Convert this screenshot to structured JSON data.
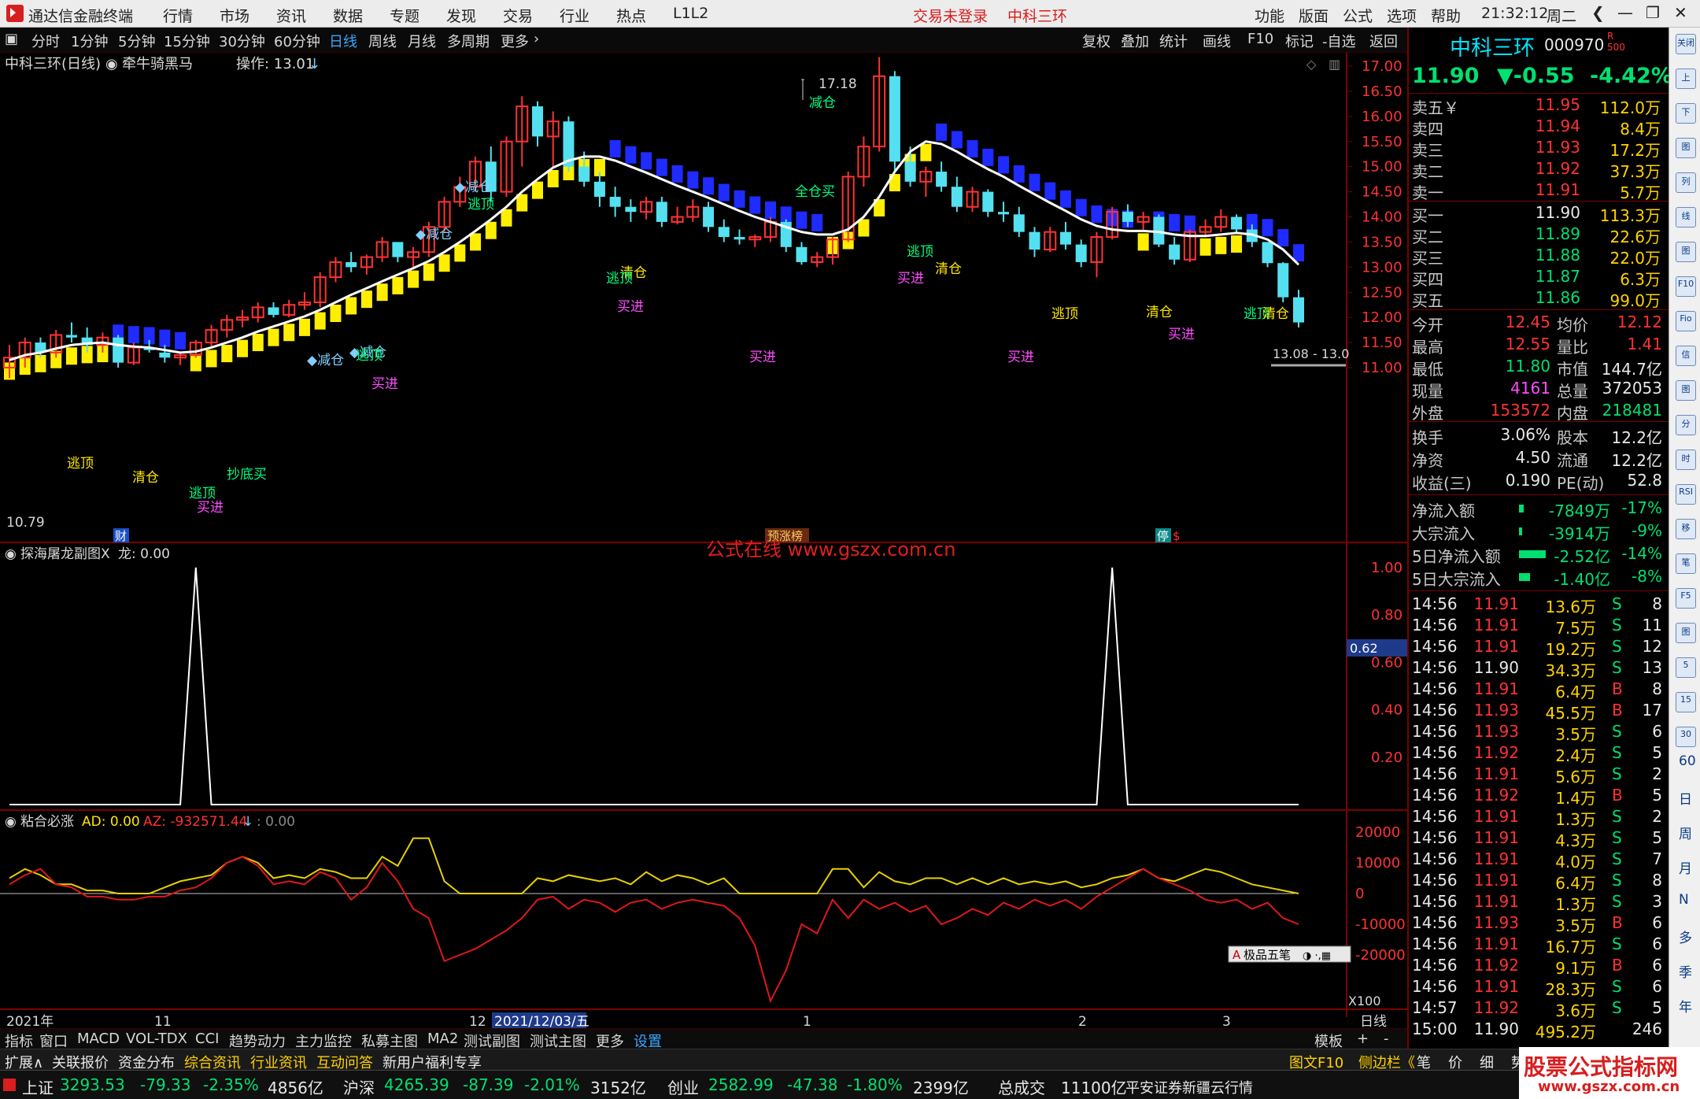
{
  "app": {
    "name": "通达信金融终端"
  },
  "menu": [
    "行情",
    "市场",
    "资讯",
    "数据",
    "专题",
    "发现",
    "交易",
    "行业",
    "热点",
    "L1L2"
  ],
  "menu_red": [
    "交易未登录",
    "中科三环"
  ],
  "menu_right": [
    "功能",
    "版面",
    "公式",
    "选项",
    "帮助"
  ],
  "clock": "21:32:12",
  "weekday": "周二",
  "toolbar_left": [
    "分时",
    "1分钟",
    "5分钟",
    "15分钟",
    "30分钟",
    "60分钟",
    "日线",
    "周线",
    "月线",
    "多周期",
    "更多"
  ],
  "toolbar_active": "日线",
  "toolbar_right": [
    "复权",
    "叠加",
    "统计",
    "画线",
    "F10",
    "标记",
    "-自选",
    "返回"
  ],
  "main_pane": {
    "title": "中科三环(日线)",
    "formula": "牵牛骑黑马",
    "operation": "操作: 13.01",
    "high_label": "17.18",
    "low_label": "10.79",
    "last_label": "13.08 - 13.0",
    "badges": {
      "cai": "财",
      "yuzhang": "预涨榜",
      "ting": "停"
    },
    "watermark": "公式在线  www.gszx.com.cn"
  },
  "sub1": {
    "title": "探海屠龙副图X",
    "value": "龙: 0.00",
    "marker": "0.62"
  },
  "sub2": {
    "title": "粘合必涨",
    "ad": "AD: 0.00",
    "az": "AZ: -932571.44",
    "extra": ": 0.00",
    "scale": "X100"
  },
  "date_axis": {
    "labels": [
      "2021年",
      "11",
      "12",
      "2021/12/03/五",
      "1",
      "2",
      "3",
      "日线"
    ]
  },
  "quote": {
    "name": "中科三环",
    "code": "000970",
    "price": "11.90",
    "change": "▼-0.55",
    "pct": "-4.42%",
    "asks": [
      {
        "label": "卖五￥",
        "price": "11.95",
        "vol": "112.0万"
      },
      {
        "label": "卖四",
        "price": "11.94",
        "vol": "8.4万"
      },
      {
        "label": "卖三",
        "price": "11.93",
        "vol": "17.2万"
      },
      {
        "label": "卖二",
        "price": "11.92",
        "vol": "37.3万"
      },
      {
        "label": "卖一",
        "price": "11.91",
        "vol": "5.7万"
      }
    ],
    "bids": [
      {
        "label": "买一",
        "price": "11.90",
        "vol": "113.3万"
      },
      {
        "label": "买二",
        "price": "11.89",
        "vol": "22.6万"
      },
      {
        "label": "买三",
        "price": "11.88",
        "vol": "22.0万"
      },
      {
        "label": "买四",
        "price": "11.87",
        "vol": "6.3万"
      },
      {
        "label": "买五",
        "price": "11.86",
        "vol": "99.0万"
      }
    ],
    "stats": [
      {
        "k1": "今开",
        "v1": "12.45",
        "c1": "red",
        "k2": "均价",
        "v2": "12.12",
        "c2": "red"
      },
      {
        "k1": "最高",
        "v1": "12.55",
        "c1": "red",
        "k2": "量比",
        "v2": "1.41",
        "c2": "red"
      },
      {
        "k1": "最低",
        "v1": "11.80",
        "c1": "green",
        "k2": "市值",
        "v2": "144.7亿",
        "c2": "white"
      },
      {
        "k1": "现量",
        "v1": "4161",
        "c1": "magenta",
        "k2": "总量",
        "v2": "372053",
        "c2": "white"
      },
      {
        "k1": "外盘",
        "v1": "153572",
        "c1": "red",
        "k2": "内盘",
        "v2": "218481",
        "c2": "green"
      }
    ],
    "stats2": [
      {
        "k1": "换手",
        "v1": "3.06%",
        "c1": "white",
        "k2": "股本",
        "v2": "12.2亿",
        "c2": "white"
      },
      {
        "k1": "净资",
        "v1": "4.50",
        "c1": "white",
        "k2": "流通",
        "v2": "12.2亿",
        "c2": "white"
      },
      {
        "k1": "收益(三)",
        "v1": "0.190",
        "c1": "white",
        "k2": "PE(动)",
        "v2": "52.8",
        "c2": "white"
      }
    ],
    "flows": [
      {
        "label": "净流入额",
        "value": "-7849万",
        "pct": "-17%"
      },
      {
        "label": "大宗流入",
        "value": "-3914万",
        "pct": "-9%"
      },
      {
        "label": "5日净流入额",
        "value": "-2.52亿",
        "pct": "-14%"
      },
      {
        "label": "5日大宗流入",
        "value": "-1.40亿",
        "pct": "-8%"
      }
    ],
    "ticks": [
      {
        "t": "14:56",
        "p": "11.91",
        "v": "13.6万",
        "s": "S",
        "n": "8"
      },
      {
        "t": "14:56",
        "p": "11.91",
        "v": "7.5万",
        "s": "S",
        "n": "11"
      },
      {
        "t": "14:56",
        "p": "11.91",
        "v": "19.2万",
        "s": "S",
        "n": "12"
      },
      {
        "t": "14:56",
        "p": "11.90",
        "v": "34.3万",
        "s": "S",
        "n": "13"
      },
      {
        "t": "14:56",
        "p": "11.91",
        "v": "6.4万",
        "s": "B",
        "n": "8"
      },
      {
        "t": "14:56",
        "p": "11.93",
        "v": "45.5万",
        "s": "B",
        "n": "17"
      },
      {
        "t": "14:56",
        "p": "11.93",
        "v": "3.5万",
        "s": "S",
        "n": "6"
      },
      {
        "t": "14:56",
        "p": "11.92",
        "v": "2.4万",
        "s": "S",
        "n": "5"
      },
      {
        "t": "14:56",
        "p": "11.91",
        "v": "5.6万",
        "s": "S",
        "n": "2"
      },
      {
        "t": "14:56",
        "p": "11.92",
        "v": "1.4万",
        "s": "B",
        "n": "5"
      },
      {
        "t": "14:56",
        "p": "11.91",
        "v": "1.3万",
        "s": "S",
        "n": "2"
      },
      {
        "t": "14:56",
        "p": "11.91",
        "v": "4.3万",
        "s": "S",
        "n": "5"
      },
      {
        "t": "14:56",
        "p": "11.91",
        "v": "4.0万",
        "s": "S",
        "n": "7"
      },
      {
        "t": "14:56",
        "p": "11.91",
        "v": "6.4万",
        "s": "S",
        "n": "8"
      },
      {
        "t": "14:56",
        "p": "11.91",
        "v": "1.3万",
        "s": "S",
        "n": "3"
      },
      {
        "t": "14:56",
        "p": "11.93",
        "v": "3.5万",
        "s": "B",
        "n": "6"
      },
      {
        "t": "14:56",
        "p": "11.91",
        "v": "16.7万",
        "s": "S",
        "n": "6"
      },
      {
        "t": "14:56",
        "p": "11.92",
        "v": "9.1万",
        "s": "B",
        "n": "6"
      },
      {
        "t": "14:56",
        "p": "11.91",
        "v": "28.3万",
        "s": "S",
        "n": "6"
      },
      {
        "t": "14:57",
        "p": "11.92",
        "v": "3.6万",
        "s": "S",
        "n": "5"
      },
      {
        "t": "15:00",
        "p": "11.90",
        "v": "495.2万",
        "s": "",
        "n": "246"
      }
    ]
  },
  "side_icons": [
    "关闭",
    "上",
    "下",
    "图",
    "列",
    "线",
    "图",
    "F10",
    "Fio",
    "信",
    "图",
    "分",
    "时",
    "RSI",
    "移",
    "笔",
    "F5",
    "图",
    "5",
    "15",
    "30",
    "60",
    "日",
    "周",
    "月",
    "N",
    "多",
    "季",
    "年"
  ],
  "tabs": [
    "指标",
    "窗口",
    "MACD",
    "VOL-TDX",
    "CCI",
    "趋势动力",
    "主力监控",
    "私募主图",
    "MA2",
    "测试副图",
    "测试主图",
    "更多",
    "设置"
  ],
  "tabs_right": [
    "模板",
    "+",
    "-"
  ],
  "tabs2": [
    "扩展∧",
    "关联报价",
    "资金分布",
    "综合资讯",
    "行业资讯",
    "互动问答",
    "新用户福利专享"
  ],
  "tabs2_right": [
    "图文F10",
    "侧边栏《",
    "笔",
    "价",
    "细",
    "势"
  ],
  "status": {
    "sh_label": "上证",
    "sh_val": "3293.53",
    "sh_chg": "-79.33",
    "sh_pct": "-2.35%",
    "sh_amt": "4856亿",
    "hs_label": "沪深",
    "hs_val": "4265.39",
    "hs_chg": "-87.39",
    "hs_pct": "-2.01%",
    "hs_amt": "3152亿",
    "cy_label": "创业",
    "cy_val": "2582.99",
    "cy_chg": "-47.38",
    "cy_pct": "-1.80%",
    "cy_amt": "2399亿",
    "total_label": "总成交",
    "total_val": "11100亿",
    "broker": "平安证券新疆云行情",
    "brand": "股票公式指标网",
    "brand_url": "www.gszx.com.cn"
  },
  "popup": {
    "label": "极品五笔"
  },
  "chart_data": {
    "type": "candlestick",
    "y_ticks": [
      "17.00",
      "16.50",
      "16.00",
      "15.50",
      "15.00",
      "14.50",
      "14.00",
      "13.50",
      "13.00",
      "12.50",
      "12.00",
      "11.50",
      "11.00"
    ],
    "ylim": [
      10.6,
      17.3
    ],
    "ohlc": [
      [
        11.0,
        11.45,
        10.79,
        11.2
      ],
      [
        11.2,
        11.6,
        11.0,
        11.5
      ],
      [
        11.5,
        11.6,
        11.2,
        11.3
      ],
      [
        11.3,
        11.75,
        11.2,
        11.65
      ],
      [
        11.65,
        11.9,
        11.5,
        11.6
      ],
      [
        11.6,
        11.8,
        11.3,
        11.45
      ],
      [
        11.45,
        11.7,
        11.3,
        11.6
      ],
      [
        11.6,
        11.65,
        11.0,
        11.1
      ],
      [
        11.1,
        11.5,
        11.05,
        11.4
      ],
      [
        11.4,
        11.55,
        11.3,
        11.35
      ],
      [
        11.3,
        11.45,
        11.1,
        11.2
      ],
      [
        11.2,
        11.3,
        11.05,
        11.25
      ],
      [
        11.25,
        11.55,
        11.2,
        11.5
      ],
      [
        11.5,
        11.85,
        11.4,
        11.75
      ],
      [
        11.75,
        12.05,
        11.6,
        11.95
      ],
      [
        11.95,
        12.15,
        11.8,
        12.0
      ],
      [
        12.0,
        12.3,
        11.9,
        12.2
      ],
      [
        12.2,
        12.3,
        12.0,
        12.05
      ],
      [
        12.05,
        12.35,
        12.0,
        12.25
      ],
      [
        12.25,
        12.5,
        12.15,
        12.3
      ],
      [
        12.3,
        12.9,
        12.2,
        12.8
      ],
      [
        12.8,
        13.2,
        12.7,
        13.1
      ],
      [
        13.1,
        13.3,
        12.9,
        13.0
      ],
      [
        13.0,
        13.25,
        12.85,
        13.2
      ],
      [
        13.2,
        13.6,
        13.1,
        13.5
      ],
      [
        13.5,
        13.45,
        13.1,
        13.2
      ],
      [
        13.2,
        13.4,
        12.95,
        13.3
      ],
      [
        13.3,
        13.9,
        13.2,
        13.8
      ],
      [
        13.8,
        14.4,
        13.7,
        14.3
      ],
      [
        14.3,
        14.8,
        14.2,
        14.6
      ],
      [
        14.6,
        15.2,
        14.5,
        15.1
      ],
      [
        15.1,
        15.4,
        14.3,
        14.5
      ],
      [
        14.5,
        15.6,
        14.4,
        15.5
      ],
      [
        15.5,
        16.4,
        15.0,
        16.2
      ],
      [
        16.2,
        16.3,
        15.4,
        15.6
      ],
      [
        15.6,
        16.1,
        15.0,
        15.9
      ],
      [
        15.9,
        16.0,
        14.9,
        15.0
      ],
      [
        15.0,
        15.3,
        14.6,
        14.7
      ],
      [
        14.7,
        14.9,
        14.2,
        14.4
      ],
      [
        14.4,
        14.6,
        14.0,
        14.2
      ],
      [
        14.2,
        14.35,
        13.9,
        14.1
      ],
      [
        14.1,
        14.4,
        13.95,
        14.3
      ],
      [
        14.3,
        14.4,
        13.8,
        13.9
      ],
      [
        13.9,
        14.2,
        13.85,
        14.0
      ],
      [
        14.0,
        14.35,
        13.9,
        14.2
      ],
      [
        14.2,
        14.3,
        13.7,
        13.8
      ],
      [
        13.8,
        13.95,
        13.5,
        13.6
      ],
      [
        13.6,
        13.75,
        13.45,
        13.55
      ],
      [
        13.55,
        13.65,
        13.4,
        13.6
      ],
      [
        13.6,
        14.0,
        13.5,
        13.9
      ],
      [
        13.9,
        13.95,
        13.3,
        13.4
      ],
      [
        13.4,
        13.5,
        13.05,
        13.1
      ],
      [
        13.1,
        13.3,
        13.0,
        13.2
      ],
      [
        13.2,
        13.6,
        13.05,
        13.55
      ],
      [
        13.55,
        14.9,
        13.5,
        14.8
      ],
      [
        14.8,
        15.6,
        14.6,
        15.4
      ],
      [
        15.4,
        17.18,
        15.3,
        16.8
      ],
      [
        16.8,
        16.9,
        14.9,
        15.1
      ],
      [
        15.1,
        15.4,
        14.6,
        14.7
      ],
      [
        14.7,
        15.0,
        14.4,
        14.9
      ],
      [
        14.9,
        15.1,
        14.5,
        14.6
      ],
      [
        14.6,
        14.8,
        14.1,
        14.2
      ],
      [
        14.2,
        14.6,
        14.1,
        14.5
      ],
      [
        14.5,
        14.55,
        14.0,
        14.1
      ],
      [
        14.1,
        14.3,
        13.9,
        14.05
      ],
      [
        14.05,
        14.2,
        13.6,
        13.7
      ],
      [
        13.7,
        13.8,
        13.2,
        13.35
      ],
      [
        13.35,
        13.8,
        13.3,
        13.7
      ],
      [
        13.7,
        13.9,
        13.35,
        13.45
      ],
      [
        13.45,
        13.55,
        13.0,
        13.1
      ],
      [
        13.1,
        13.7,
        12.8,
        13.6
      ],
      [
        13.6,
        14.2,
        13.55,
        14.1
      ],
      [
        14.1,
        14.25,
        13.8,
        13.9
      ],
      [
        13.9,
        14.1,
        13.7,
        14.0
      ],
      [
        14.0,
        14.05,
        13.4,
        13.45
      ],
      [
        13.45,
        13.6,
        13.05,
        13.15
      ],
      [
        13.15,
        13.75,
        13.1,
        13.7
      ],
      [
        13.7,
        13.95,
        13.6,
        13.8
      ],
      [
        13.8,
        14.15,
        13.7,
        14.0
      ],
      [
        14.0,
        14.05,
        13.7,
        13.75
      ],
      [
        13.75,
        13.85,
        13.4,
        13.5
      ],
      [
        13.5,
        13.45,
        13.0,
        13.08
      ],
      [
        13.08,
        13.1,
        12.3,
        12.4
      ],
      [
        12.4,
        12.55,
        11.8,
        11.9
      ]
    ],
    "ma": [
      11.15,
      11.25,
      11.3,
      11.38,
      11.45,
      11.48,
      11.5,
      11.45,
      11.42,
      11.4,
      11.35,
      11.3,
      11.32,
      11.4,
      11.5,
      11.6,
      11.72,
      11.82,
      11.92,
      12.02,
      12.15,
      12.3,
      12.45,
      12.58,
      12.72,
      12.85,
      12.98,
      13.12,
      13.3,
      13.5,
      13.72,
      13.95,
      14.2,
      14.5,
      14.75,
      14.98,
      15.12,
      15.2,
      15.2,
      15.12,
      15.0,
      14.88,
      14.75,
      14.62,
      14.5,
      14.38,
      14.25,
      14.12,
      14.0,
      13.9,
      13.8,
      13.7,
      13.65,
      13.65,
      13.75,
      14.0,
      14.4,
      14.9,
      15.3,
      15.5,
      15.45,
      15.3,
      15.12,
      14.95,
      14.8,
      14.62,
      14.45,
      14.28,
      14.12,
      13.95,
      13.82,
      13.75,
      13.72,
      13.72,
      13.7,
      13.65,
      13.62,
      13.62,
      13.65,
      13.68,
      13.65,
      13.55,
      13.35,
      13.05
    ],
    "sub1_peaks": [
      12,
      71
    ],
    "sub2_y_ticks": [
      "20000",
      "10000",
      "0",
      "-10000",
      "-20000"
    ],
    "sub2_yellow": [
      5000,
      8000,
      6000,
      3000,
      3000,
      1000,
      1000,
      0,
      0,
      0,
      2000,
      4000,
      5000,
      6000,
      10000,
      12000,
      10000,
      5000,
      6000,
      5000,
      8000,
      7000,
      5000,
      5000,
      12000,
      9000,
      18000,
      18000,
      4000,
      0,
      0,
      0,
      0,
      0,
      5000,
      4000,
      6000,
      5000,
      4000,
      5000,
      3000,
      7000,
      4000,
      6000,
      5000,
      3000,
      5000,
      0,
      0,
      0,
      0,
      0,
      0,
      8000,
      8000,
      2000,
      7000,
      4000,
      3000,
      5000,
      5000,
      3000,
      5000,
      3000,
      5000,
      3000,
      4000,
      3000,
      4000,
      2000,
      3000,
      5000,
      6000,
      8000,
      5000,
      4000,
      6000,
      8000,
      7000,
      5000,
      3000,
      2000,
      1000,
      0
    ],
    "sub2_red": [
      3000,
      6000,
      8000,
      3000,
      2000,
      -1000,
      -1000,
      -2000,
      -2000,
      -1000,
      -1000,
      1000,
      2000,
      5000,
      10000,
      12000,
      9000,
      3000,
      4000,
      3000,
      7000,
      5000,
      -2000,
      2000,
      10000,
      4000,
      -5000,
      -8000,
      -22000,
      -20000,
      -18000,
      -15000,
      -12000,
      -8000,
      -2000,
      -1000,
      -5000,
      -2000,
      -3000,
      -6000,
      -3000,
      -2000,
      -5000,
      -3000,
      -2000,
      -3000,
      -4000,
      -8000,
      -17000,
      -35000,
      -25000,
      -10000,
      -13000,
      -2000,
      -8000,
      -2000,
      -5000,
      -3000,
      -6000,
      -4000,
      -10000,
      -8000,
      -5000,
      -7000,
      -3000,
      -5000,
      -2000,
      -4000,
      -2000,
      -5000,
      -1000,
      2000,
      5000,
      8000,
      5000,
      3000,
      1000,
      -2000,
      -3000,
      -2000,
      -5000,
      -3000,
      -8000,
      -10000
    ]
  }
}
